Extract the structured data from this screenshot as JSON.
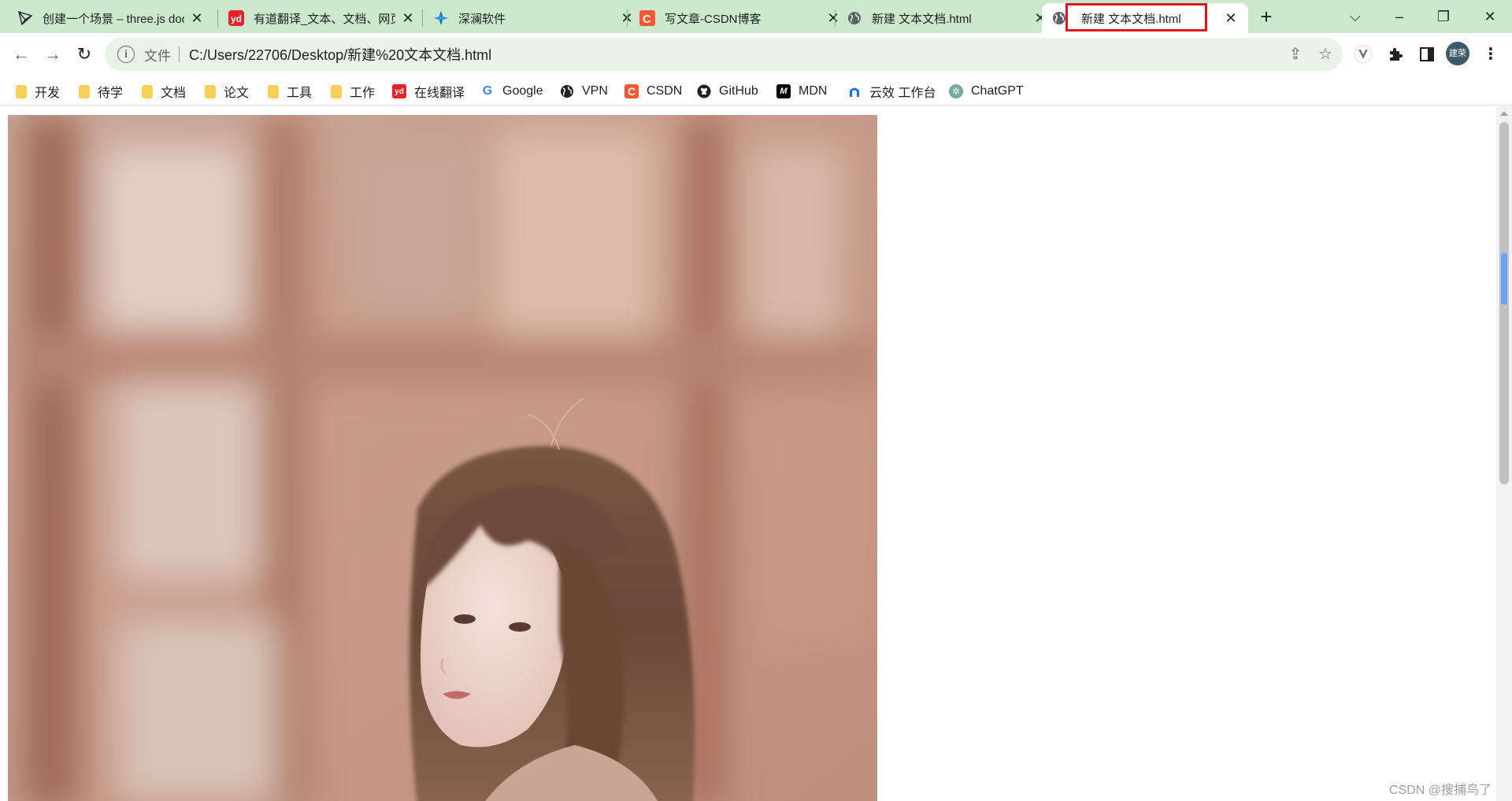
{
  "tabs": [
    {
      "title": "创建一个场景 – three.js docs",
      "icon": "threejs-icon"
    },
    {
      "title": "有道翻译_文本、文档、网页翻译",
      "icon": "youdao-icon"
    },
    {
      "title": "深澜软件",
      "icon": "srun-icon"
    },
    {
      "title": "写文章-CSDN博客",
      "icon": "csdn-icon"
    },
    {
      "title": "新建 文本文档.html",
      "icon": "globe-icon"
    },
    {
      "title": "新建 文本文档.html",
      "icon": "globe-icon",
      "active": true
    }
  ],
  "address_bar": {
    "scheme_label": "文件",
    "url": "C:/Users/22706/Desktop/新建%20文本文档.html"
  },
  "profile": {
    "avatar_text": "建荣"
  },
  "bookmarks": [
    {
      "label": "开发",
      "type": "folder"
    },
    {
      "label": "待学",
      "type": "folder"
    },
    {
      "label": "文档",
      "type": "folder"
    },
    {
      "label": "论文",
      "type": "folder"
    },
    {
      "label": "工具",
      "type": "folder"
    },
    {
      "label": "工作",
      "type": "folder"
    },
    {
      "label": "在线翻译",
      "type": "link",
      "icon": "youdao-icon"
    },
    {
      "label": "Google",
      "type": "link",
      "icon": "google-icon"
    },
    {
      "label": "VPN",
      "type": "link",
      "icon": "globe-icon"
    },
    {
      "label": "CSDN",
      "type": "link",
      "icon": "csdn-icon"
    },
    {
      "label": "GitHub",
      "type": "link",
      "icon": "github-icon"
    },
    {
      "label": "MDN",
      "type": "link",
      "icon": "mdn-icon"
    },
    {
      "label": "云效 工作台",
      "type": "link",
      "icon": "yunxiao-icon"
    },
    {
      "label": "ChatGPT",
      "type": "link",
      "icon": "chatgpt-icon"
    }
  ],
  "content": {
    "image_description_icon": "photo-portrait"
  },
  "watermark": "CSDN @搜捕鸟了",
  "colors": {
    "tabstrip_bg": "#cce8cc",
    "omnibox_bg": "#e9f3ea",
    "highlight_border": "#e0141e"
  }
}
